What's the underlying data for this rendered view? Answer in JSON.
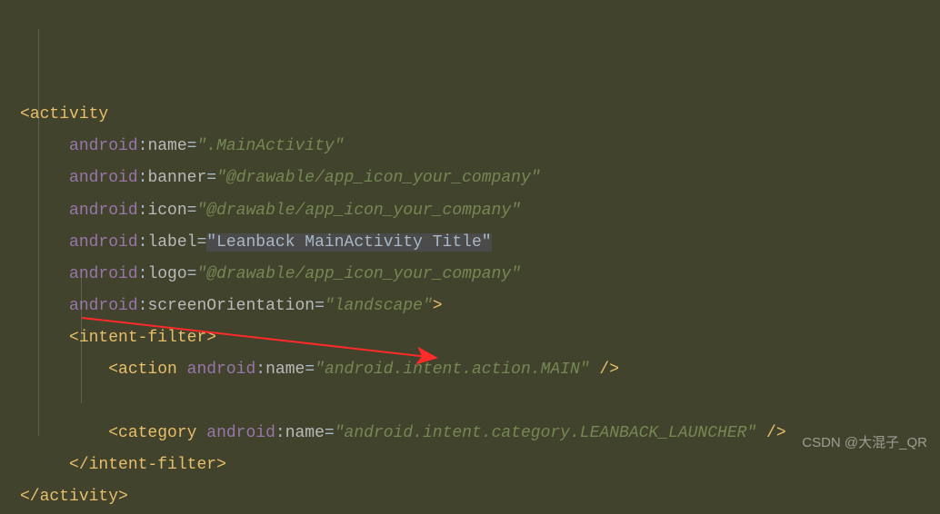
{
  "code": {
    "tag_activity_open": "activity",
    "tag_activity_close": "activity",
    "tag_intentfilter_open": "intent-filter",
    "tag_intentfilter_close": "intent-filter",
    "tag_action": "action",
    "tag_category": "category",
    "ns": "android",
    "attrs": {
      "name": "name",
      "banner": "banner",
      "icon": "icon",
      "label": "label",
      "logo": "logo",
      "screenOrientation": "screenOrientation"
    },
    "vals": {
      "name": ".MainActivity",
      "banner": "@drawable/app_icon_your_company",
      "icon": "@drawable/app_icon_your_company",
      "label": "Leanback MainActivity Title",
      "logo": "@drawable/app_icon_your_company",
      "screenOrientation": "landscape",
      "action_name": "android.intent.action.MAIN",
      "category_name": "android.intent.category.LEANBACK_LAUNCHER"
    },
    "selfclose": " /",
    "gt": ">"
  },
  "watermark": "CSDN @大混子_QR"
}
